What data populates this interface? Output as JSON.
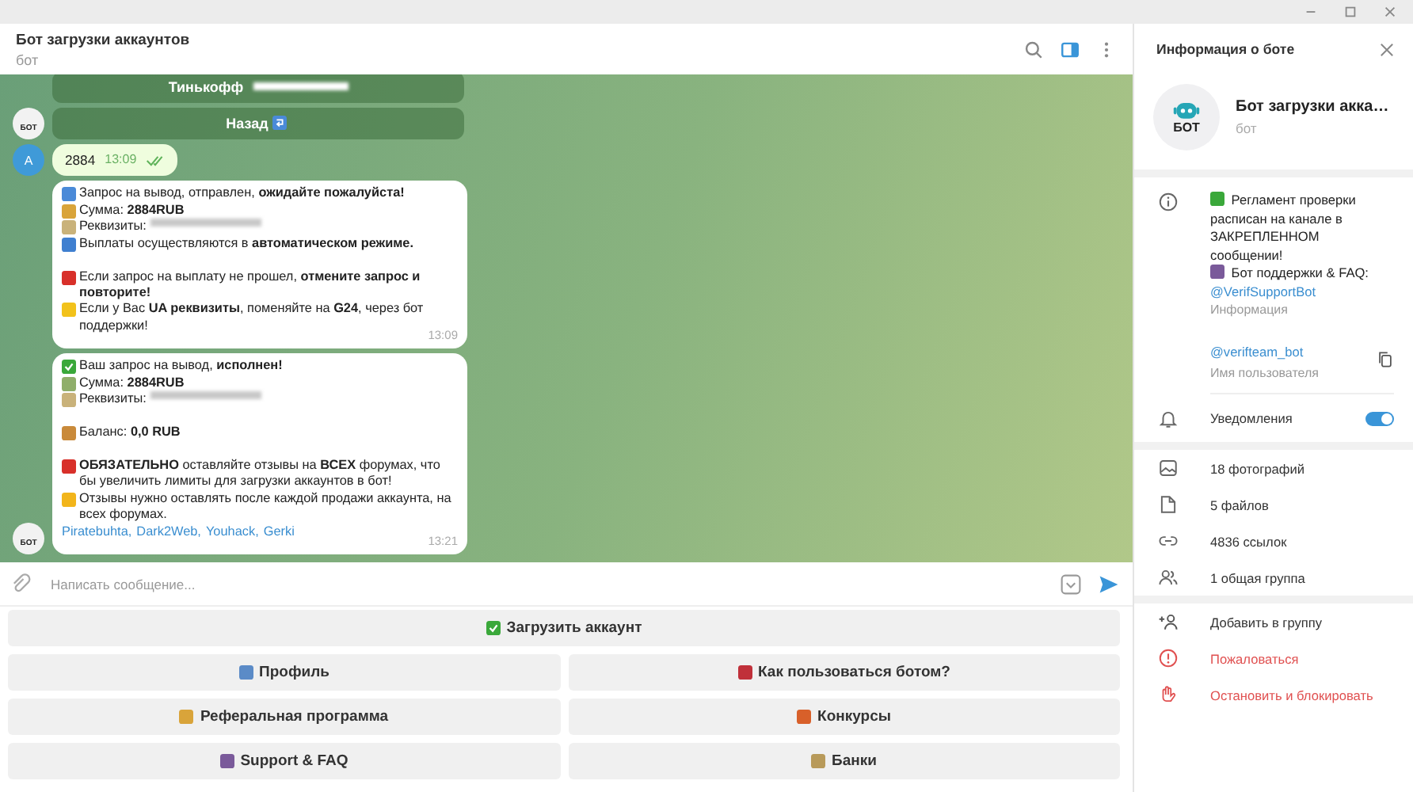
{
  "chat_header": {
    "title": "Бот загрузки аккаунтов",
    "subtitle": "бот"
  },
  "messages": [
    {
      "kind": "buttons",
      "bot_avatar": "БОТ",
      "buttons": [
        {
          "text": "Тинькофф",
          "kind": "redacted"
        },
        {
          "text": "Назад",
          "kind": "return"
        }
      ]
    },
    {
      "kind": "outgoing",
      "avatar": "A",
      "text": "2884",
      "time": "13:09",
      "read": true
    },
    {
      "kind": "incoming",
      "time": "13:09",
      "lines": [
        {
          "kind": "refresh",
          "text": "Запрос на вывод,  отправлен, **ожидайте пожалуйста!**"
        },
        {
          "kind": "money",
          "text": "Сумма: **2884RUB**"
        },
        {
          "kind": "card",
          "text": "Реквизиты:",
          "redacted": true
        },
        {
          "kind": "info",
          "text": "Выплаты осуществляются в **автоматическом режиме.**"
        },
        {
          "kind": "gap"
        },
        {
          "kind": "stop",
          "text": "Если запрос на выплату не прошел, **отмените запрос и повторите!**"
        },
        {
          "kind": "yellow",
          "text": "Если у Вас **UA реквизиты**, поменяйте на **G24**, через бот поддержки!"
        }
      ]
    },
    {
      "kind": "incoming",
      "time": "13:21",
      "bot_avatar": "БОТ",
      "lines": [
        {
          "kind": "check",
          "text": "Ваш запрос на вывод, **исполнен!**"
        },
        {
          "kind": "bills",
          "text": "Сумма: **2884RUB**"
        },
        {
          "kind": "card",
          "text": "Реквизиты:",
          "redacted": true
        },
        {
          "kind": "gap"
        },
        {
          "kind": "bag",
          "text": "Баланс: **0,0 RUB**"
        },
        {
          "kind": "gap"
        },
        {
          "kind": "exclaim",
          "text": "**ОБЯЗАТЕЛЬНО** оставляйте отзывы на **ВСЕХ** форумах, что бы увеличить лимиты для загрузки аккаунтов в бот!"
        },
        {
          "kind": "bolt",
          "text": "Отзывы нужно оставлять после каждой продажи аккаунта, на всех форумах."
        }
      ],
      "links": [
        "Piratebuhta,",
        "Dark2Web,",
        "Youhack,",
        "Gerki"
      ]
    }
  ],
  "composer": {
    "placeholder": "Написать сообщение..."
  },
  "keyboard": [
    [
      {
        "kind": "check",
        "text": "Загрузить аккаунт"
      }
    ],
    [
      {
        "kind": "person",
        "text": "Профиль"
      },
      {
        "kind": "book",
        "text": "Как пользоваться ботом?"
      }
    ],
    [
      {
        "kind": "megaphone",
        "text": "Реферальная программа"
      },
      {
        "kind": "gift",
        "text": "Конкурсы"
      }
    ],
    [
      {
        "kind": "books",
        "text": "Support & FAQ"
      },
      {
        "kind": "bank",
        "text": "Банки"
      }
    ]
  ],
  "info_panel": {
    "title": "Информация о боте",
    "name": "Бот загрузки акка…",
    "subtitle": "бот",
    "avatar_label": "БОТ",
    "about": [
      {
        "kind": "recycle",
        "text": "Регламент проверки расписан на канале в ЗАКРЕПЛЕННОМ сообщении!"
      },
      {
        "kind": "books",
        "text": "Бот поддержки & FAQ:",
        "link": "@VerifSupportBot"
      }
    ],
    "about_label": "Информация",
    "username": "@verifteam_bot",
    "username_label": "Имя пользователя",
    "notifications": {
      "label": "Уведомления",
      "on": true
    },
    "media": [
      {
        "kind": "photo",
        "text": "18 фотографий"
      },
      {
        "kind": "file",
        "text": "5 файлов"
      },
      {
        "kind": "link",
        "text": "4836 ссылок"
      },
      {
        "kind": "group",
        "text": "1 общая группа"
      }
    ],
    "actions": [
      {
        "kind": "add",
        "text": "Добавить в группу",
        "danger": false
      },
      {
        "kind": "report",
        "text": "Пожаловаться",
        "danger": true
      },
      {
        "kind": "block",
        "text": "Остановить и блокировать",
        "danger": true
      }
    ]
  }
}
